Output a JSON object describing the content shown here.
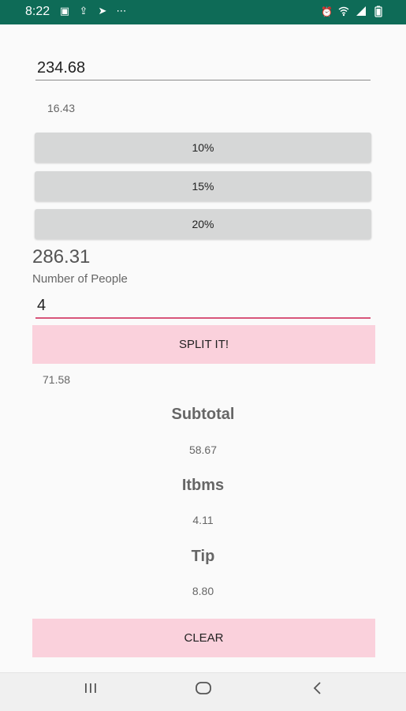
{
  "status_bar": {
    "time": "8:22",
    "left_icons": [
      "image-icon",
      "upload-icon",
      "send-icon",
      "more-icon"
    ],
    "right_icons": [
      "alarm-icon",
      "wifi-icon",
      "signal-icon",
      "battery-icon"
    ]
  },
  "calculator": {
    "bill_amount": "234.68",
    "tip_amount": "16.43",
    "tip_options": [
      "10%",
      "15%",
      "20%"
    ],
    "total": "286.31",
    "people_label": "Number of People",
    "people_count": "4",
    "split_button": "SPLIT IT!",
    "per_person": "71.58"
  },
  "breakdown": {
    "subtotal_label": "Subtotal",
    "subtotal_value": "58.67",
    "itbms_label": "Itbms",
    "itbms_value": "4.11",
    "tip_label": "Tip",
    "tip_value": "8.80"
  },
  "clear_button": "CLEAR",
  "colors": {
    "status_bar": "#0e6b57",
    "accent_pink": "#fad1dc",
    "input_underline_active": "#d8557a",
    "tip_button": "#d6d7d7"
  }
}
